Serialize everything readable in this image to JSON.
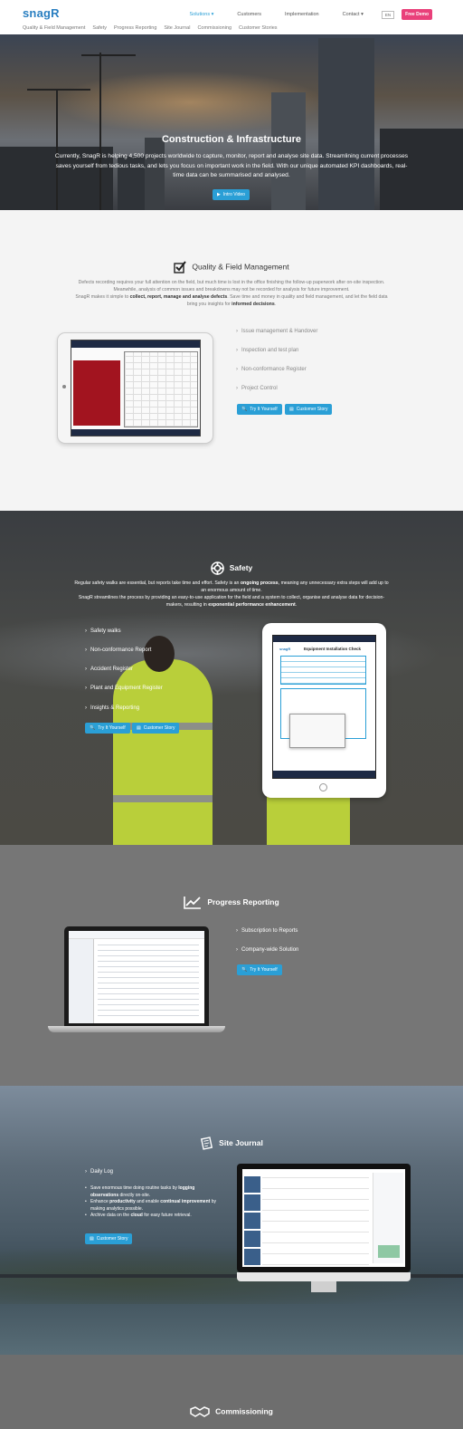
{
  "header": {
    "logo": "snagR",
    "nav": [
      "Solutions",
      "Customers",
      "Implementation",
      "Contact"
    ],
    "lang": "EN",
    "demo": "Free Demo",
    "subnav": [
      "Quality & Field Management",
      "Safety",
      "Progress Reporting",
      "Site Journal",
      "Commissioning",
      "Customer Stories"
    ]
  },
  "hero": {
    "title": "Construction & Infrastructure",
    "text": "Currently, SnagR is helping 4,500 projects worldwide to capture, monitor, report and analyse site data. Streamlining current processes saves yourself from tedious tasks, and lets you focus on important work in the field. With our unique automated KPI dashboards, real-time data can be summarised and analysed.",
    "button": "Intro Video"
  },
  "quality": {
    "title": "Quality & Field Management",
    "p1": "Defects recording requires your full attention on the field, but much time is lost in the office finishing the follow-up paperwork after on-site inspection. Meanwhile, analysis of common issues and breakdowns may not be recorded for analysis for future improvement.",
    "p2_a": "SnagR makes it simple to ",
    "p2_b": "collect, report, manage and analyse defects",
    "p2_c": ". Save time and money in quality and field management, and let the field data bring you insights for ",
    "p2_d": "informed decisions",
    "p2_e": ".",
    "features": [
      "Issue management & Handover",
      "Inspection and test plan",
      "Non-conformance Register",
      "Project Control"
    ],
    "btn_try": "Try It Yourself",
    "btn_story": "Customer Story"
  },
  "safety": {
    "title": "Safety",
    "p1_a": "Regular safety walks are essential, but reports take time and effort. Safety is an ",
    "p1_b": "ongoing process",
    "p1_c": ", meaning any unnecessary extra steps will add up to an enormous amount of time.",
    "p2_a": "SnagR streamlines the process by providing an easy-to-use application for the field and a system to collect, organise and analyse data for decision-makers, resulting in ",
    "p2_b": "exponential performance enhancement",
    "p2_c": ".",
    "features": [
      "Safety walks",
      "Non-conformance Report",
      "Accident Register",
      "Plant and Equipment Register",
      "Insights & Reporting"
    ],
    "btn_try": "Try It Yourself",
    "btn_story": "Customer Story",
    "tablet_logo": "snagR",
    "tablet_title": "Equipment Installation Check"
  },
  "progress": {
    "title": "Progress Reporting",
    "features": [
      "Subscription to Reports",
      "Company-wide Solution"
    ],
    "btn_try": "Try It Yourself"
  },
  "journal": {
    "title": "Site Journal",
    "feature": "Daily Log",
    "b1_a": "Save enormous time doing routine tasks by ",
    "b1_b": "logging observations",
    "b1_c": " directly on-site.",
    "b2_a": "Enhance ",
    "b2_b": "productivity",
    "b2_c": " and enable ",
    "b2_d": "continual improvement",
    "b2_e": " by making analytics possible.",
    "b3_a": "Archive data on the ",
    "b3_b": "cloud",
    "b3_c": " for easy future retrieval.",
    "btn_story": "Customer Story"
  },
  "commissioning": {
    "title": "Commissioning"
  }
}
